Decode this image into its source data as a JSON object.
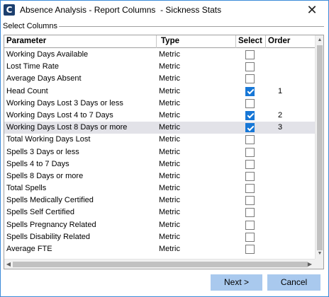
{
  "window": {
    "app_icon": "C",
    "title": "Absence Analysis - Report Columns  - Sickness Stats",
    "close_glyph": "✕"
  },
  "group": {
    "label": "Select Columns"
  },
  "grid": {
    "columns": {
      "parameter": "Parameter",
      "type": "Type",
      "select": "Select",
      "order": "Order"
    },
    "rows": [
      {
        "parameter": "Working Days Available",
        "type": "Metric",
        "selected": false,
        "order": ""
      },
      {
        "parameter": "Lost Time Rate",
        "type": "Metric",
        "selected": false,
        "order": ""
      },
      {
        "parameter": "Average Days Absent",
        "type": "Metric",
        "selected": false,
        "order": ""
      },
      {
        "parameter": "Head Count",
        "type": "Metric",
        "selected": true,
        "order": "1"
      },
      {
        "parameter": "Working Days Lost 3 Days or less",
        "type": "Metric",
        "selected": false,
        "order": ""
      },
      {
        "parameter": "Working Days Lost 4 to 7 Days",
        "type": "Metric",
        "selected": true,
        "order": "2"
      },
      {
        "parameter": "Working Days Lost 8 Days or more",
        "type": "Metric",
        "selected": true,
        "order": "3",
        "highlighted": true
      },
      {
        "parameter": "Total Working Days Lost",
        "type": "Metric",
        "selected": false,
        "order": ""
      },
      {
        "parameter": "Spells 3 Days or less",
        "type": "Metric",
        "selected": false,
        "order": ""
      },
      {
        "parameter": "Spells 4 to 7 Days",
        "type": "Metric",
        "selected": false,
        "order": ""
      },
      {
        "parameter": "Spells 8 Days or more",
        "type": "Metric",
        "selected": false,
        "order": ""
      },
      {
        "parameter": "Total Spells",
        "type": "Metric",
        "selected": false,
        "order": ""
      },
      {
        "parameter": "Spells Medically Certified",
        "type": "Metric",
        "selected": false,
        "order": ""
      },
      {
        "parameter": "Spells Self Certified",
        "type": "Metric",
        "selected": false,
        "order": ""
      },
      {
        "parameter": "Spells Pregnancy Related",
        "type": "Metric",
        "selected": false,
        "order": ""
      },
      {
        "parameter": "Spells Disability Related",
        "type": "Metric",
        "selected": false,
        "order": ""
      },
      {
        "parameter": "Average FTE",
        "type": "Metric",
        "selected": false,
        "order": ""
      }
    ]
  },
  "buttons": {
    "next": "Next >",
    "cancel": "Cancel"
  },
  "colors": {
    "accent": "#1777d6",
    "button_bg": "#a9c9ee",
    "row_highlight": "#e2e2e8",
    "window_border": "#3c8bd9"
  }
}
